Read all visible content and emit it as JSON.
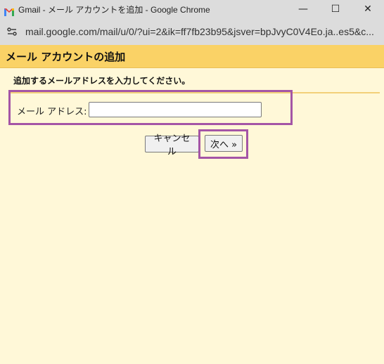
{
  "window": {
    "title": "Gmail - メール アカウントを追加 - Google Chrome",
    "controls": {
      "minimize": "—",
      "maximize": "☐",
      "close": "✕"
    }
  },
  "addressbar": {
    "url": "mail.google.com/mail/u/0/?ui=2&ik=ff7fb23b95&jsver=bpJvyC0V4Eo.ja..es5&c..."
  },
  "dialog": {
    "title": "メール アカウントの追加",
    "instruction": "追加するメールアドレスを入力してください。",
    "email_label": "メール アドレス:",
    "email_value": "",
    "cancel_label": "キャンセル",
    "next_label": "次へ »"
  },
  "colors": {
    "header": "#fad266",
    "background": "#fff8d8",
    "highlight": "#a455a6"
  }
}
